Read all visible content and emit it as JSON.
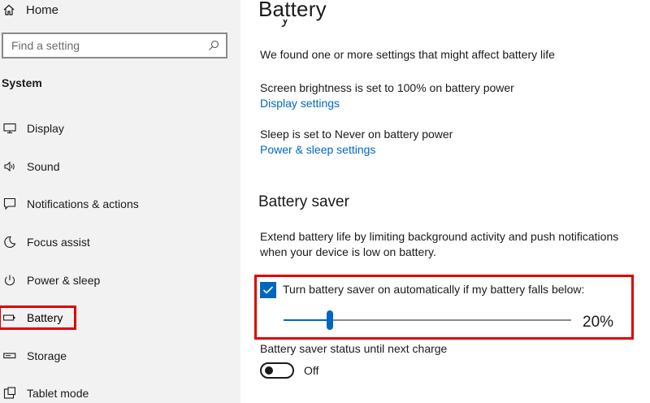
{
  "sidebar": {
    "home_label": "Home",
    "search_placeholder": "Find a setting",
    "section_title": "System",
    "items": [
      {
        "label": "Display",
        "icon": "monitor-icon"
      },
      {
        "label": "Sound",
        "icon": "speaker-icon"
      },
      {
        "label": "Notifications & actions",
        "icon": "notifications-icon"
      },
      {
        "label": "Focus assist",
        "icon": "moon-icon"
      },
      {
        "label": "Power & sleep",
        "icon": "power-icon"
      },
      {
        "label": "Battery",
        "icon": "battery-icon",
        "active": true
      },
      {
        "label": "Storage",
        "icon": "storage-icon"
      },
      {
        "label": "Tablet mode",
        "icon": "tablet-icon"
      }
    ]
  },
  "main": {
    "title": "Battery",
    "overview_cut": "y",
    "notice": "We found one or more settings that might affect battery life",
    "brightness_text": "Screen brightness is set to 100% on battery power",
    "display_link": "Display settings",
    "sleep_text": "Sleep is set to Never on battery power",
    "power_link": "Power & sleep settings",
    "saver_heading": "Battery saver",
    "saver_desc_1": "Extend battery life by limiting background activity and push notifications",
    "saver_desc_2": "when your device is low on battery.",
    "auto_checkbox_label": "Turn battery saver on automatically if my battery falls below:",
    "auto_checked": true,
    "threshold_value": 20,
    "threshold_text": "20%",
    "status_label": "Battery saver status until next charge",
    "toggle_state": "Off",
    "toggle_on": false
  },
  "colors": {
    "accent": "#0067c0",
    "highlight": "#e00000",
    "sidebar_bg": "#f2f2f2"
  }
}
